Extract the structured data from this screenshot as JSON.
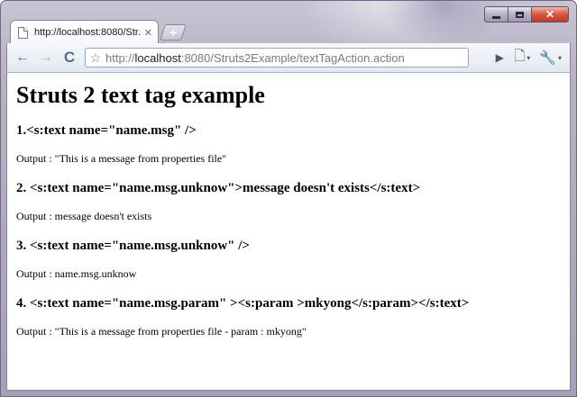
{
  "window": {
    "caption_minimize": "",
    "caption_maximize": "",
    "caption_close": "✕"
  },
  "tabs": [
    {
      "title": "http://localhost:8080/Str...",
      "close_glyph": "✕"
    }
  ],
  "new_tab_glyph": "+",
  "toolbar": {
    "back_glyph": "←",
    "forward_glyph": "→",
    "reload_glyph": "C",
    "star_glyph": "☆",
    "go_glyph": "▶",
    "page_glyph": "🗋",
    "tools_glyph": "🔧",
    "caret": "▾"
  },
  "address": {
    "proto": "http://",
    "host": "localhost",
    "rest": ":8080/Struts2Example/textTagAction.action"
  },
  "page": {
    "title": "Struts 2 text tag example",
    "sections": [
      {
        "heading": "1.<s:text name=\"name.msg\" />",
        "output": "Output : \"This is a message from properties file\""
      },
      {
        "heading": "2. <s:text name=\"name.msg.unknow\">message doesn't exists</s:text>",
        "output": "Output : message doesn't exists"
      },
      {
        "heading": "3. <s:text name=\"name.msg.unknow\" />",
        "output": "Output : name.msg.unknow"
      },
      {
        "heading": "4. <s:text name=\"name.msg.param\" ><s:param >mkyong</s:param></s:text>",
        "output": "Output : \"This is a message from properties file - param : mkyong\""
      }
    ]
  },
  "colors": {
    "frame": "#b9b2c6",
    "close_button": "#d9533b",
    "toolbar": "#e3e8f1"
  },
  "icons": [
    "page-favicon-icon",
    "close-icon",
    "back-arrow-icon",
    "forward-arrow-icon",
    "reload-icon",
    "star-icon",
    "go-icon",
    "page-menu-icon",
    "wrench-icon"
  ]
}
